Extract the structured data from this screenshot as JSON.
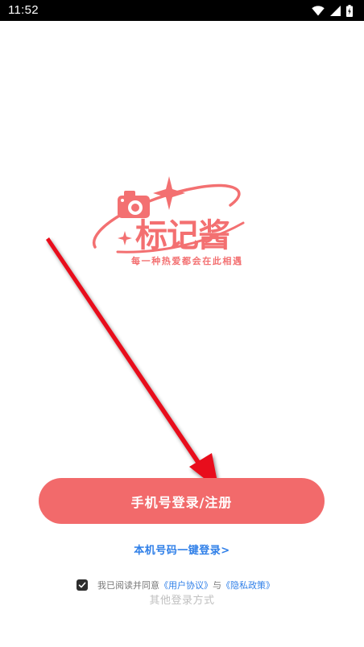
{
  "status_bar": {
    "time": "11:52",
    "icons": [
      "wifi-icon",
      "signal-icon",
      "battery-icon"
    ]
  },
  "logo": {
    "brand_name": "标记酱",
    "slogan": "每一种热爱都会在此相遇",
    "color": "#f37071"
  },
  "login": {
    "primary_button_label": "手机号登录/注册",
    "one_key_label": "本机号码一键登录>",
    "other_login_label": "其他登录方式"
  },
  "agreement": {
    "checked": true,
    "prefix": "我已阅读并同意",
    "user_agreement": "《用户协议》",
    "conjunction": "与",
    "privacy_policy": "《隐私政策》"
  },
  "colors": {
    "accent": "#f26a6b",
    "link": "#2f7fe8",
    "annotation_arrow": "#e8101a"
  }
}
